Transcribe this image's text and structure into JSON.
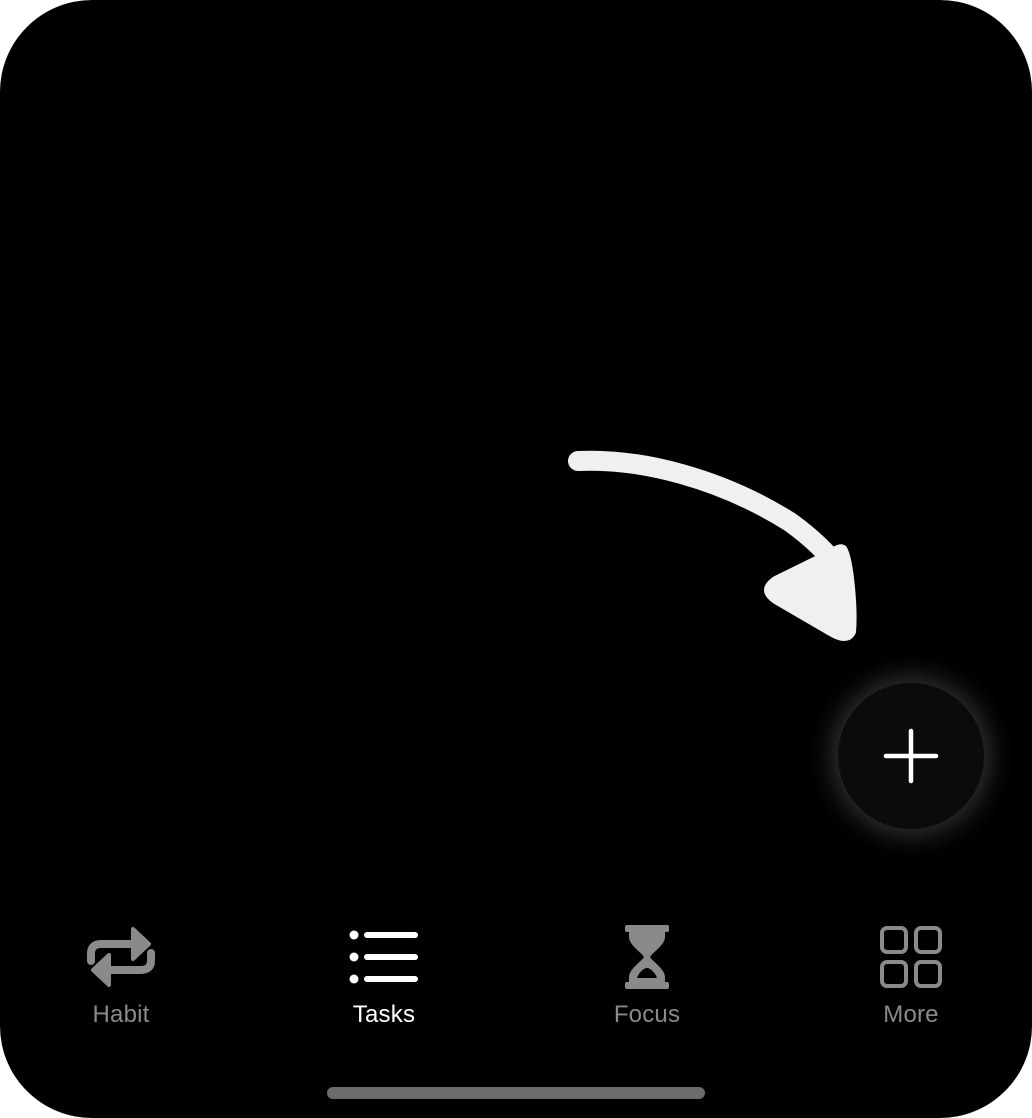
{
  "fab": {
    "icon": "plus-icon"
  },
  "annotation": {
    "icon": "curved-arrow-icon",
    "color": "#f0f0f0"
  },
  "tabbar": {
    "active_tab": "Tasks",
    "active_color": "#ffffff",
    "inactive_color": "#8a8a8a",
    "tabs": [
      {
        "label": "Habit",
        "icon": "repeat-icon"
      },
      {
        "label": "Tasks",
        "icon": "list-icon"
      },
      {
        "label": "Focus",
        "icon": "hourglass-icon"
      },
      {
        "label": "More",
        "icon": "grid-icon"
      }
    ]
  }
}
